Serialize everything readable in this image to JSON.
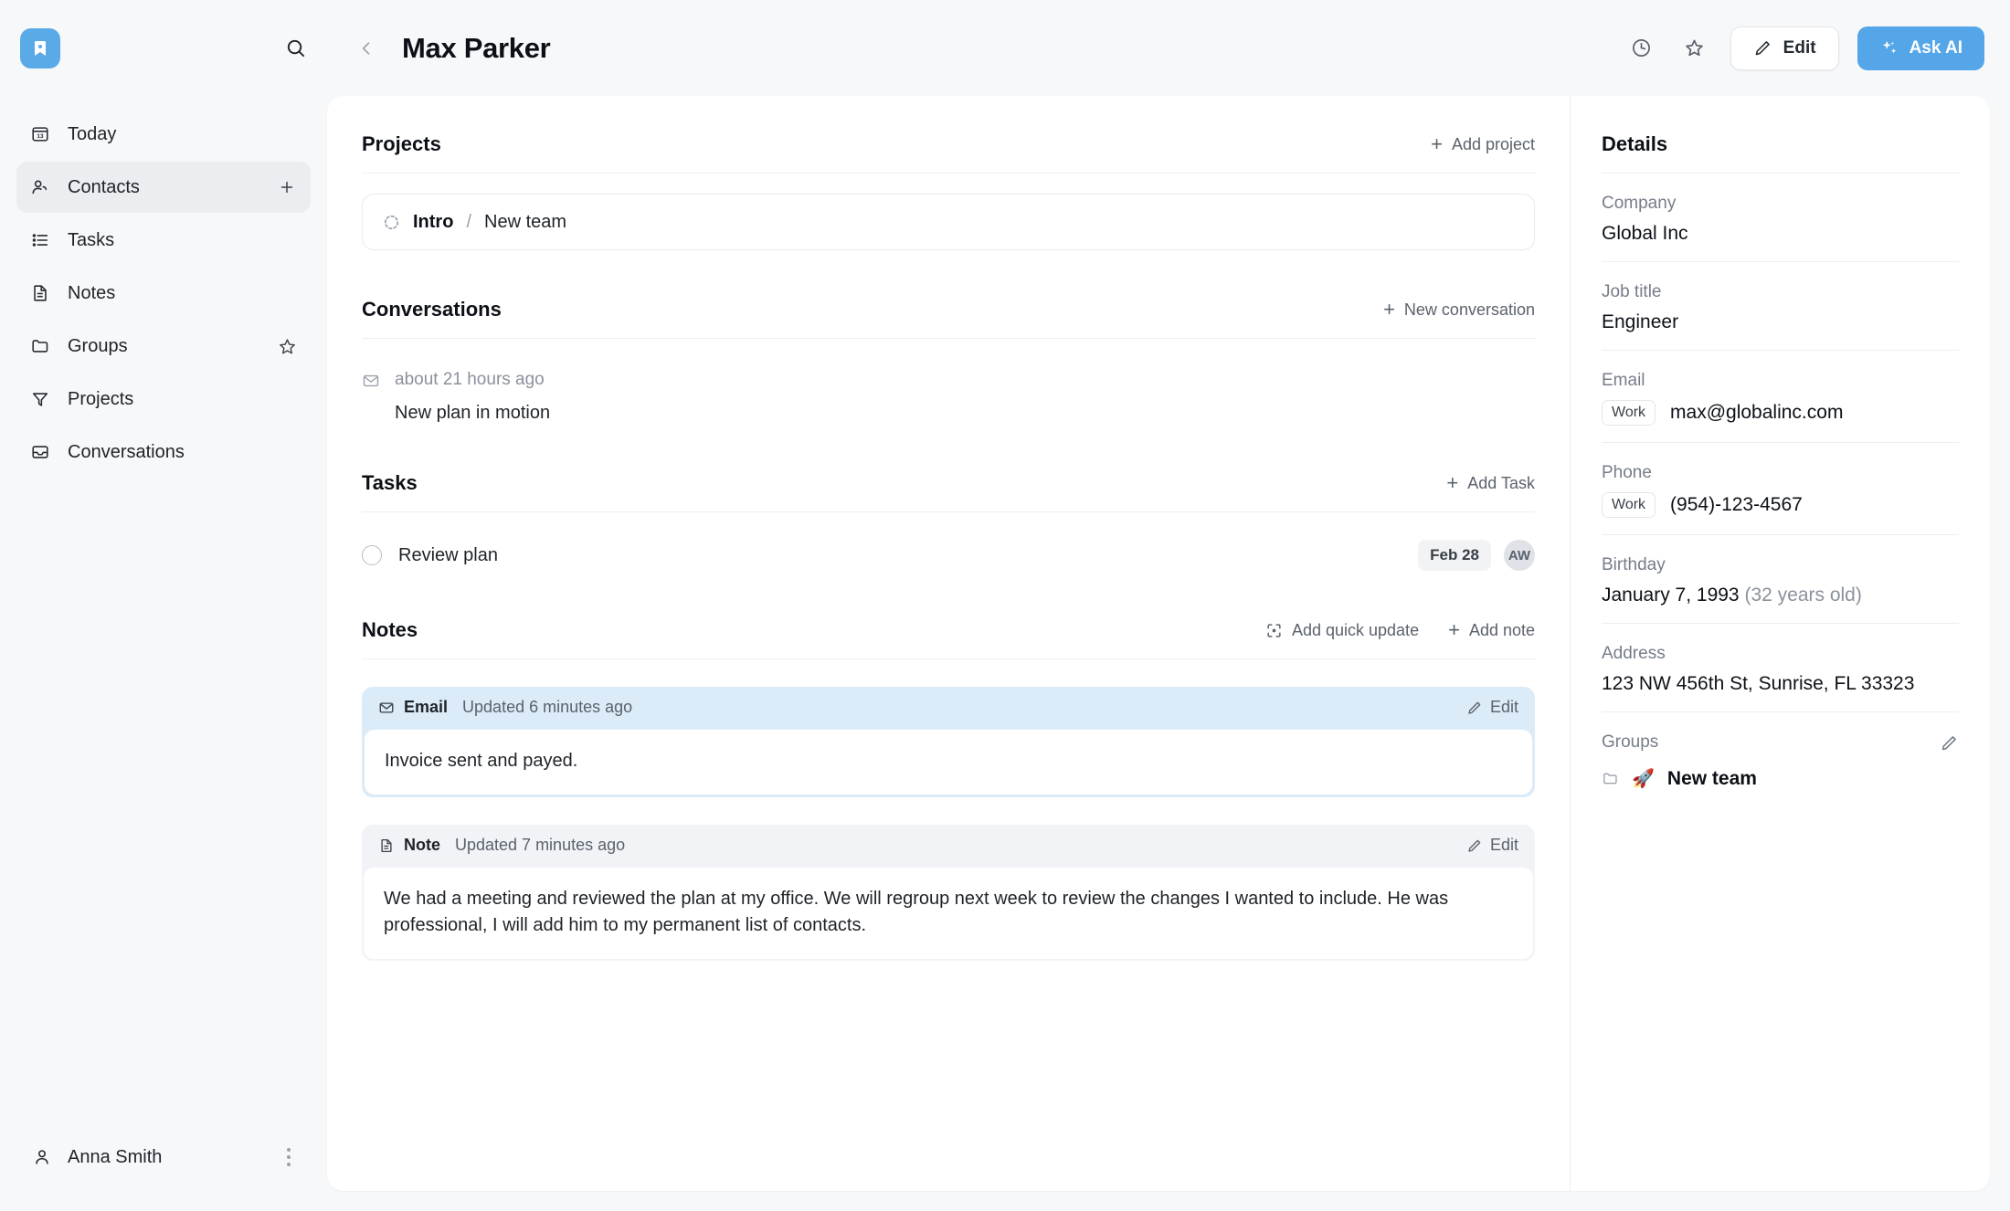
{
  "app": {
    "logo_icon": "bookmark-icon",
    "accent_color": "#55a6e8",
    "search_icon": "search-icon"
  },
  "header": {
    "back_icon": "chevron-left-icon",
    "title": "Max Parker",
    "history_icon": "clock-icon",
    "favorite_icon": "star-icon",
    "edit_label": "Edit",
    "edit_icon": "pencil-icon",
    "ask_ai_label": "Ask AI",
    "ask_ai_icon": "sparkles-icon"
  },
  "sidebar": {
    "items": [
      {
        "label": "Today",
        "icon": "calendar-13-icon",
        "trailing": "",
        "active": false
      },
      {
        "label": "Contacts",
        "icon": "users-icon",
        "trailing": "plus-icon",
        "active": true
      },
      {
        "label": "Tasks",
        "icon": "list-icon",
        "trailing": "",
        "active": false
      },
      {
        "label": "Notes",
        "icon": "document-icon",
        "trailing": "",
        "active": false
      },
      {
        "label": "Groups",
        "icon": "folder-icon",
        "trailing": "star-icon",
        "active": false
      },
      {
        "label": "Projects",
        "icon": "funnel-icon",
        "trailing": "",
        "active": false
      },
      {
        "label": "Conversations",
        "icon": "inbox-icon",
        "trailing": "",
        "active": false
      }
    ],
    "user": {
      "name": "Anna Smith",
      "icon": "person-icon",
      "menu_icon": "kebab-menu-icon"
    }
  },
  "main": {
    "projects": {
      "title": "Projects",
      "add_label": "Add project",
      "items": [
        {
          "icon": "dotted-circle-icon",
          "name": "Intro",
          "separator": "/",
          "group": "New team"
        }
      ]
    },
    "conversations": {
      "title": "Conversations",
      "add_label": "New conversation",
      "items": [
        {
          "icon": "envelope-icon",
          "time": "about 21 hours ago",
          "subject": "New plan in motion"
        }
      ]
    },
    "tasks": {
      "title": "Tasks",
      "add_label": "Add Task",
      "items": [
        {
          "name": "Review plan",
          "date": "Feb 28",
          "assignee_initials": "AW"
        }
      ]
    },
    "notes": {
      "title": "Notes",
      "quick_update_label": "Add quick update",
      "quick_update_icon": "focus-dot-icon",
      "add_note_label": "Add note",
      "edit_label": "Edit",
      "items": [
        {
          "kind": "Email",
          "kind_icon": "envelope-icon",
          "updated": "Updated 6 minutes ago",
          "body": "Invoice sent and payed.",
          "variant": "email"
        },
        {
          "kind": "Note",
          "kind_icon": "document-icon",
          "updated": "Updated 7 minutes ago",
          "body": "We had a meeting and reviewed the plan at my office. We will regroup next week to review the changes I wanted to include. He was professional, I will add him to my permanent list of contacts.",
          "variant": "note"
        }
      ]
    }
  },
  "details": {
    "title": "Details",
    "company": {
      "label": "Company",
      "value": "Global Inc"
    },
    "job_title": {
      "label": "Job title",
      "value": "Engineer"
    },
    "email": {
      "label": "Email",
      "tag": "Work",
      "value": "max@globalinc.com"
    },
    "phone": {
      "label": "Phone",
      "tag": "Work",
      "value": "(954)-123-4567"
    },
    "birthday": {
      "label": "Birthday",
      "value": "January 7, 1993",
      "age": "(32 years old)"
    },
    "address": {
      "label": "Address",
      "value": "123 NW 456th St, Sunrise, FL 33323"
    },
    "groups": {
      "label": "Groups",
      "edit_icon": "pencil-icon",
      "items": [
        {
          "folder_icon": "folder-icon",
          "emoji": "🚀",
          "name": "New team"
        }
      ]
    }
  }
}
